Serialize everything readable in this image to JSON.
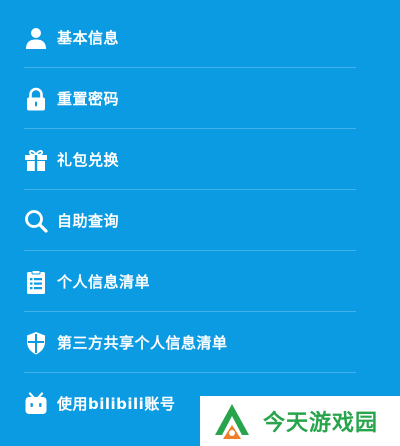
{
  "menu": {
    "items": [
      {
        "label": "基本信息",
        "icon": "user-icon"
      },
      {
        "label": "重置密码",
        "icon": "lock-icon"
      },
      {
        "label": "礼包兑换",
        "icon": "gift-icon"
      },
      {
        "label": "自助查询",
        "icon": "search-icon"
      },
      {
        "label": "个人信息清单",
        "icon": "clipboard-list-icon"
      },
      {
        "label": "第三方共享个人信息清单",
        "icon": "shield-icon"
      },
      {
        "label": "使用bilibili账号",
        "icon": "bilibili-tv-icon"
      }
    ]
  },
  "watermark": {
    "text": "今天游戏园",
    "logo_text": "今天游戏园"
  },
  "colors": {
    "background": "#0b9be3",
    "text": "#ffffff",
    "watermark_green": "#28a54c",
    "watermark_orange": "#f07d2a"
  }
}
